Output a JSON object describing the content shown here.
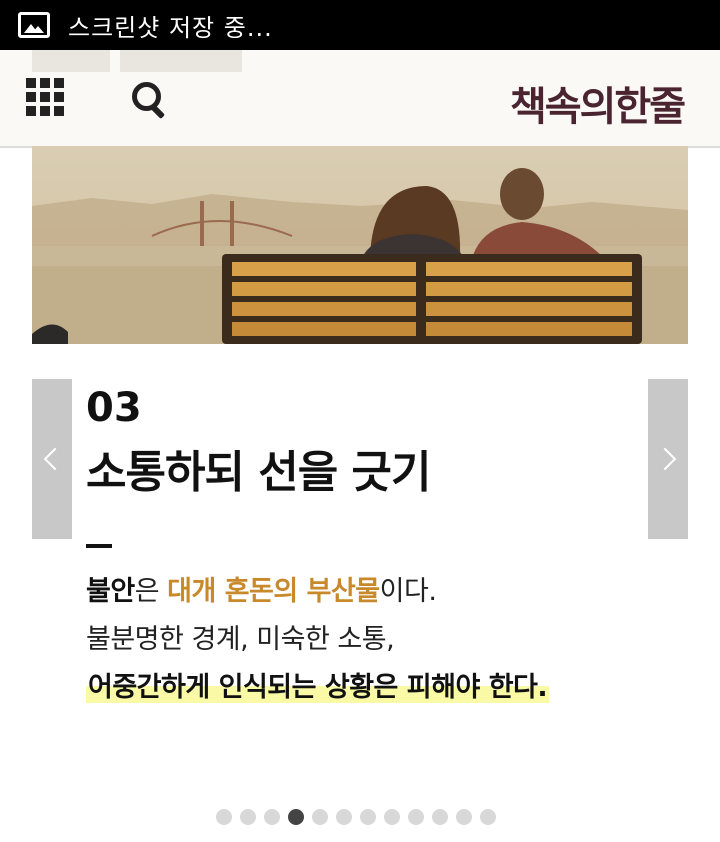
{
  "status_bar": {
    "text": "스크린샷 저장 중...",
    "icon": "image-icon"
  },
  "app_bar": {
    "logo": "책속의한줄",
    "menu_icon": "grid-menu-icon",
    "search_icon": "search-icon",
    "logo_color": "#4a2430"
  },
  "card": {
    "number": "03",
    "heading": "소통하되 선을 긋기",
    "line1": {
      "bold": "불안",
      "plain1": "은 ",
      "highlight": "대개 혼돈의 부산물",
      "plain2": "이다."
    },
    "line2": "불분명한 경계, 미숙한 소통,",
    "line3": "어중간하게 인식되는 상황은 피해야 한다.",
    "accent_color": "#c8892a",
    "highlight_color": "#fafaa6"
  },
  "carousel": {
    "slide_count": 12,
    "active_index": 3,
    "prev_icon": "chevron-left-icon",
    "next_icon": "chevron-right-icon"
  }
}
